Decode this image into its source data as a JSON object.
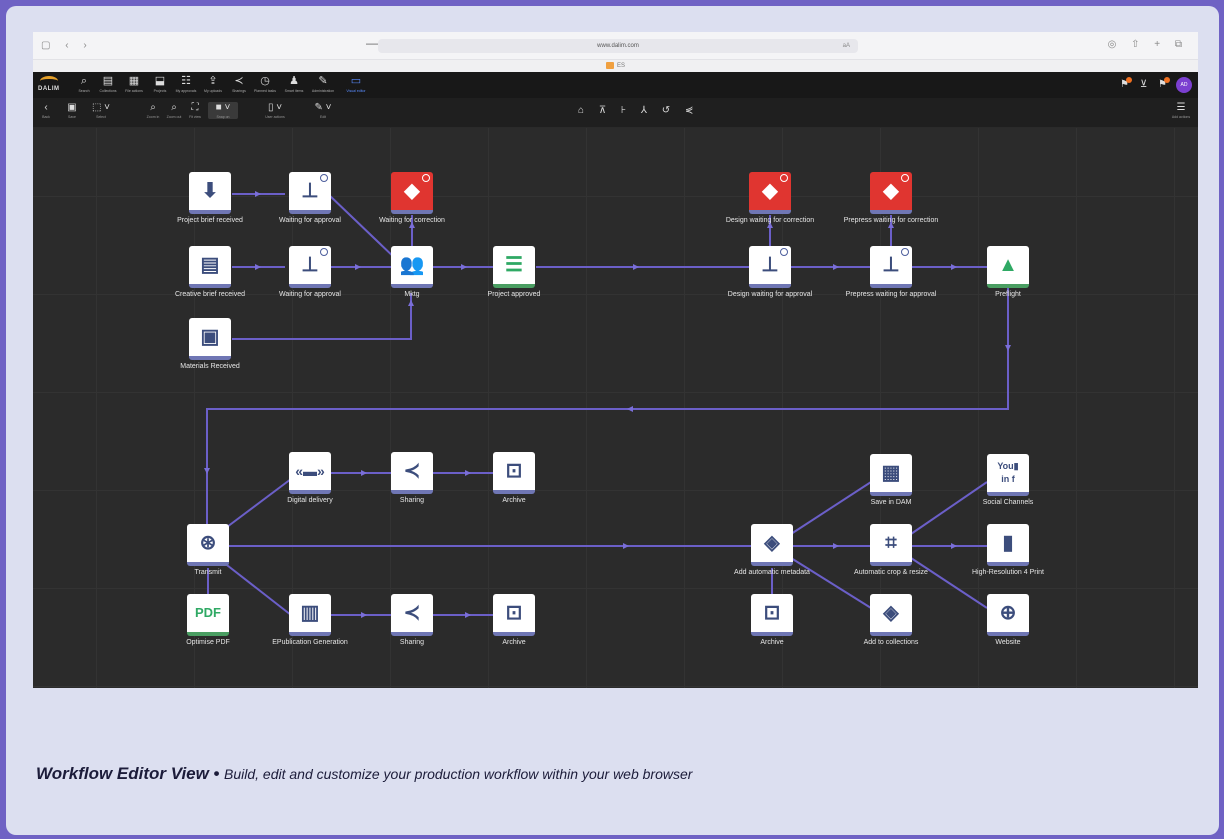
{
  "browser": {
    "url": "www.dalim.com",
    "reader_icon": "aA",
    "tab_label": "ES"
  },
  "app": {
    "logo_text": "DALIM",
    "nav": [
      {
        "id": "search",
        "icon": "search-icon",
        "label": "Search"
      },
      {
        "id": "collections",
        "icon": "collections-icon",
        "label": "Collections"
      },
      {
        "id": "my-jobs",
        "icon": "jobs-icon",
        "label": "File actions"
      },
      {
        "id": "projects",
        "icon": "projects-icon",
        "label": "Projects"
      },
      {
        "id": "approvals",
        "icon": "approvals-icon",
        "label": "My approvals"
      },
      {
        "id": "uploads",
        "icon": "upload-icon",
        "label": "My uploads"
      },
      {
        "id": "sharings",
        "icon": "share-icon",
        "label": "Sharings"
      },
      {
        "id": "planned",
        "icon": "clock-icon",
        "label": "Planned tasks"
      },
      {
        "id": "smart",
        "icon": "smart-icon",
        "label": "Smart items"
      },
      {
        "id": "admin",
        "icon": "wrench-icon",
        "label": "Administration"
      },
      {
        "id": "editor",
        "icon": "monitor-icon",
        "label": "Visual editor"
      }
    ],
    "avatar": "AD"
  },
  "toolbar": {
    "back": "Back",
    "save": "Save",
    "select": "Select",
    "zoom_in": "Zoom in",
    "zoom_out": "Zoom out",
    "fit": "Fit view",
    "snap": "Snap on",
    "user_actions": "User actions",
    "edit": "Edit",
    "add_actions": "Add actions"
  },
  "nodes": {
    "project_brief": "Project brief received",
    "waiting_1": "Waiting for approval",
    "waiting_correction": "Waiting for correction",
    "creative_brief": "Creative brief received",
    "waiting_2": "Waiting for approval",
    "mktg": "Mktg",
    "project_approved": "Project approved",
    "materials": "Materials Received",
    "design_correction": "Design waiting for correction",
    "prepress_correction": "Prepress waiting for correction",
    "design_approval": "Design waiting for approval",
    "prepress_approval": "Prepress waiting for approval",
    "preflight": "Preflight",
    "digital_delivery": "Digital delivery",
    "sharing_1": "Sharing",
    "archive_1": "Archive",
    "transmit": "Transmit",
    "optimise_pdf": "Optimise PDF",
    "epub": "EPublication Generation",
    "sharing_2": "Sharing",
    "archive_2": "Archive",
    "add_metadata": "Add automatic metadata",
    "archive_3": "Archive",
    "save_dam": "Save in DAM",
    "crop": "Automatic crop & resize",
    "add_collections": "Add to collections",
    "social": "Social Channels",
    "hires": "High-Resolution 4 Print",
    "website": "Website"
  },
  "caption": {
    "title": "Workflow Editor View",
    "subtitle": "Build, edit and customize your production workflow within your web browser"
  },
  "colors": {
    "background": "#6f62c4",
    "canvas": "#2b2b2b",
    "link": "#6b5fc8",
    "accent_red": "#e03530",
    "accent_green": "#2fa964"
  }
}
